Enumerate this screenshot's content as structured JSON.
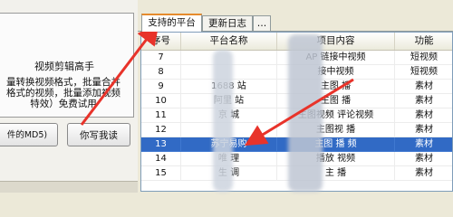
{
  "left": {
    "promo_title": "视频剪辑高手",
    "promo_lines": [
      "量转换视频格式，批量合并",
      "格式的视频，批量添加视频",
      "特效）免费试用"
    ],
    "button_a": "件的MD5)",
    "button_b": "你写我读"
  },
  "tabs": [
    {
      "label": "支持的平台"
    },
    {
      "label": "更新日志"
    },
    {
      "label": "…"
    }
  ],
  "table": {
    "headers": [
      "序号",
      "平台名称",
      "项目内容",
      "功能"
    ],
    "rows": [
      {
        "no": "7",
        "platform": "",
        "content": "AP   链接中视频",
        "func": "短视频"
      },
      {
        "no": "8",
        "platform": "",
        "content": "   接中视频",
        "func": "短视频"
      },
      {
        "no": "9",
        "platform": "1688   站",
        "content": "主图   播",
        "func": "素材"
      },
      {
        "no": "10",
        "platform": "阿里   站",
        "content": "主图   播",
        "func": "素材"
      },
      {
        "no": "11",
        "platform": "京   城",
        "content": "主图视频   评论视频",
        "func": "素材"
      },
      {
        "no": "12",
        "platform": "",
        "content": "主图视   播",
        "func": "素材"
      },
      {
        "no": "13",
        "platform": "苏宁易购",
        "content": "主图   播   频",
        "func": "素材",
        "selected": true
      },
      {
        "no": "14",
        "platform": "唯   理",
        "content": "播放   视频",
        "func": "素材"
      },
      {
        "no": "15",
        "platform": "生   调",
        "content": "主   播",
        "func": "素材"
      }
    ]
  },
  "colors": {
    "selection": "#316ac5",
    "arrow": "#e8332a",
    "tab_accent": "#e68b2c"
  }
}
